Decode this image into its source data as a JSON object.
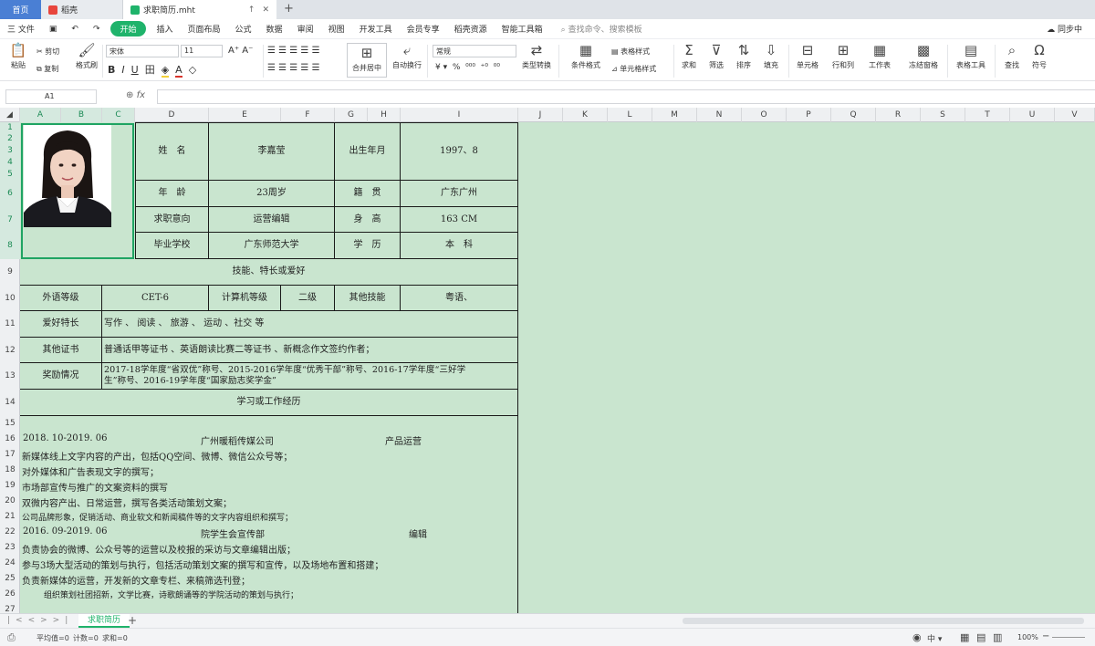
{
  "tabs": {
    "home": "首页",
    "app": "稻壳",
    "doc": "求职简历.mht"
  },
  "menu": {
    "file": "三 文件",
    "items": [
      "开始",
      "插入",
      "页面布局",
      "公式",
      "数据",
      "审阅",
      "视图",
      "开发工具",
      "会员专享",
      "稻壳资源",
      "智能工具箱"
    ],
    "search_placeholder": "查找命令、搜索模板",
    "sync": "同步中"
  },
  "ribbon": {
    "paste": "粘贴",
    "cut": "剪切",
    "copy": "复制",
    "format_painter": "格式刷",
    "font_name": "宋体",
    "font_size": "11",
    "merge_center": "合并居中",
    "wrap_text": "自动换行",
    "number_format": "常规",
    "type_convert": "类型转换",
    "conditional_format": "条件格式",
    "table_style": "表格样式",
    "cell_style": "单元格样式",
    "sum": "求和",
    "filter": "筛选",
    "sort": "排序",
    "fill": "填充",
    "cells": "单元格",
    "rows_cols": "行和列",
    "worksheet": "工作表",
    "freeze": "冻结窗格",
    "table_tools": "表格工具",
    "find": "查找",
    "symbol": "符号"
  },
  "formula_bar": {
    "cell_ref": "A1",
    "fx": "fx",
    "content": ""
  },
  "columns": [
    "A",
    "B",
    "C",
    "D",
    "E",
    "F",
    "G",
    "H",
    "I",
    "J",
    "K",
    "L",
    "M",
    "N",
    "O",
    "P",
    "Q",
    "R",
    "S",
    "T",
    "U",
    "V"
  ],
  "rows": [
    "1",
    "2",
    "3",
    "4",
    "5",
    "6",
    "7",
    "8",
    "9",
    "10",
    "11",
    "12",
    "13",
    "14",
    "15",
    "16",
    "17",
    "18",
    "19",
    "20",
    "21",
    "22",
    "23",
    "24",
    "25",
    "26",
    "27"
  ],
  "resume": {
    "name_label": "姓　名",
    "name": "李嘉莹",
    "birth_label": "出生年月",
    "birth": "1997、8",
    "age_label": "年　龄",
    "age": "23周岁",
    "native_label": "籍　贯",
    "native": "广东广州",
    "intent_label": "求职意向",
    "intent": "运营编辑",
    "height_label": "身　高",
    "height": "163 CM",
    "school_label": "毕业学校",
    "school": "广东师范大学",
    "edu_label": "学　历",
    "edu": "本　科",
    "skills_title": "技能、特长或爱好",
    "lang_label": "外语等级",
    "lang": "CET-6",
    "computer_label": "计算机等级",
    "computer": "二级",
    "other_skill_label": "其他技能",
    "other_skill": "粤语、",
    "hobby_label": "爱好特长",
    "hobby": "写作 、 阅读 、 旅游 、 运动 、社交 等",
    "cert_label": "其他证书",
    "cert": "普通话甲等证书 、英语朗读比赛二等证书 、新概念作文签约作者；",
    "award_label": "奖励情况",
    "award_line1": "2017-18学年度“省双优”称号、2015-2016学年度“优秀干部”称号、2016-17学年度“三好学",
    "award_line2": "生”称号、2016-19学年度“国家励志奖学金”",
    "exp_title": "学习或工作经历",
    "job1_date": "2018. 10-2019. 06",
    "job1_org": "广州暖稻传媒公司",
    "job1_role": "产品运营",
    "job1_lines": [
      "新媒体线上文字内容的产出，包括QQ空间、微博、微信公众号等；",
      "对外媒体和广告表现文字的撰写；",
      "市场部宣传与推广的文案资料的撰写",
      "双微内容产出、日常运营，撰写各类活动策划文案；",
      "公司品牌形象，促销活动、商业软文和新闻稿件等的文字内容组织和撰写；"
    ],
    "job2_date": "2016. 09-2019. 06",
    "job2_org": "院学生会宣传部",
    "job2_role": "编辑",
    "job2_lines": [
      "负责协会的微博、公众号等的运营以及校报的采访与文章编辑出版；",
      "参与3场大型活动的策划与执行，包括活动策划文案的撰写和宣传，以及场地布置和搭建；",
      "负责新媒体的运营，开发新的文章专栏、来稿筛选刊登；",
      "组织策划社团招新，文学比赛，诗歌朗诵等的学院活动的策划与执行；"
    ]
  },
  "sheet_tab": "求职简历",
  "status": {
    "avg": "平均值=0",
    "count": "计数=0",
    "sum": "求和=0",
    "zoom": "100%"
  },
  "colors": {
    "accent": "#1fb36b",
    "sheet_bg": "#c9e5cf",
    "home_tab": "#4a7fd4"
  }
}
